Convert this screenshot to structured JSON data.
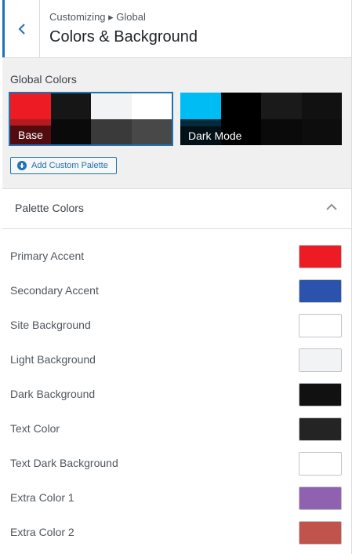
{
  "header": {
    "breadcrumb": "Customizing ▸ Global",
    "title": "Colors & Background"
  },
  "global_colors": {
    "label": "Global Colors",
    "palettes": [
      {
        "name": "Base",
        "selected": true,
        "swatches": [
          "#ed1c24",
          "#161616",
          "#f2f3f5",
          "#ffffff",
          "#b51a20",
          "#0a0a0a",
          "#3a3a3a",
          "#484848"
        ]
      },
      {
        "name": "Dark Mode",
        "selected": false,
        "swatches": [
          "#00bcf5",
          "#000000",
          "#1a1a1a",
          "#111111",
          "#052b3a",
          "#000000",
          "#0a0a0a",
          "#0d0d0d"
        ]
      }
    ],
    "add_button": "Add Custom Palette"
  },
  "palette_colors": {
    "title": "Palette Colors",
    "items": [
      {
        "label": "Primary Accent",
        "color": "#ed1c24"
      },
      {
        "label": "Secondary Accent",
        "color": "#2b53ab"
      },
      {
        "label": "Site Background",
        "color": "#ffffff"
      },
      {
        "label": "Light Background",
        "color": "#f2f3f5"
      },
      {
        "label": "Dark Background",
        "color": "#111111"
      },
      {
        "label": "Text Color",
        "color": "#242424"
      },
      {
        "label": "Text Dark Background",
        "color": "#ffffff"
      },
      {
        "label": "Extra Color 1",
        "color": "#9161b1"
      },
      {
        "label": "Extra Color 2",
        "color": "#c0544c"
      }
    ]
  }
}
